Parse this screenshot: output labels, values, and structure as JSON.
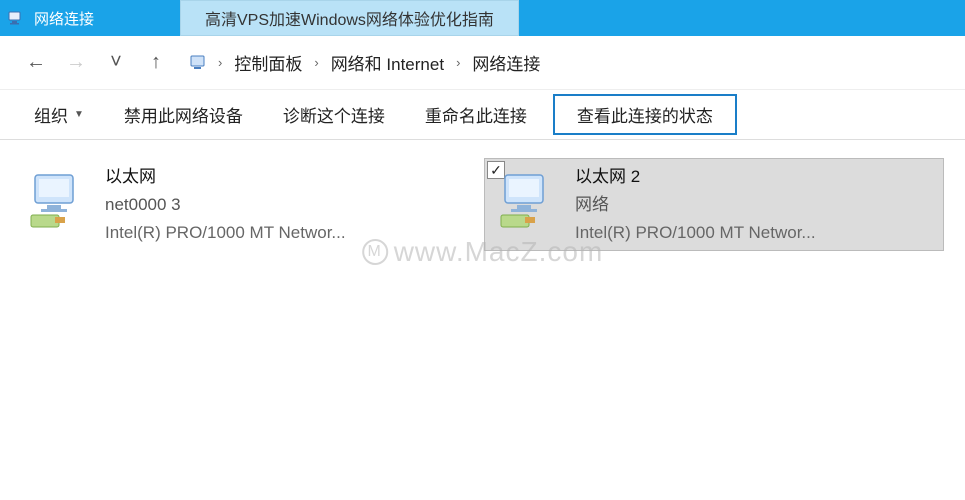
{
  "titlebar": {
    "title": "网络连接"
  },
  "banner": {
    "text": "高清VPS加速Windows网络体验优化指南"
  },
  "nav": {
    "back": "←",
    "forward": "→",
    "recent": "˅",
    "up": "↑"
  },
  "breadcrumb": {
    "items": [
      "控制面板",
      "网络和 Internet",
      "网络连接"
    ],
    "sep": "›"
  },
  "toolbar": {
    "organize": "组织",
    "disable": "禁用此网络设备",
    "diagnose": "诊断这个连接",
    "rename": "重命名此连接",
    "view_status": "查看此连接的状态"
  },
  "connections": [
    {
      "name": "以太网",
      "status": "net0000  3",
      "device": "Intel(R) PRO/1000 MT Networ...",
      "selected": false
    },
    {
      "name": "以太网 2",
      "status": "网络",
      "device": "Intel(R) PRO/1000 MT Networ...",
      "selected": true
    }
  ],
  "watermark": {
    "text": "www.MacZ.com",
    "mark": "M"
  }
}
